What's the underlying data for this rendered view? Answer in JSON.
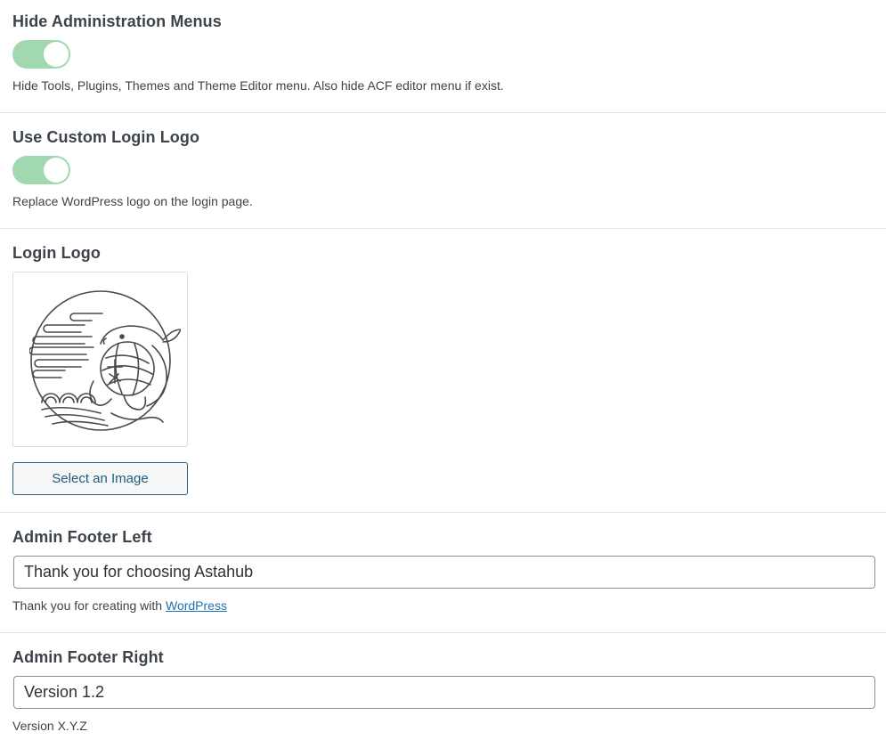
{
  "hide_admin_menus": {
    "label": "Hide Administration Menus",
    "enabled": true,
    "description": "Hide Tools, Plugins, Themes and Theme Editor menu. Also hide ACF editor menu if exist."
  },
  "custom_login_logo": {
    "label": "Use Custom Login Logo",
    "enabled": true,
    "description": "Replace WordPress logo on the login page."
  },
  "login_logo": {
    "label": "Login Logo",
    "image_icon": "mascot-logo-icon",
    "select_button": "Select an Image"
  },
  "footer_left": {
    "label": "Admin Footer Left",
    "value": "Thank you for choosing Astahub",
    "description_prefix": "Thank you for creating with ",
    "description_link": "WordPress"
  },
  "footer_right": {
    "label": "Admin Footer Right",
    "value": "Version 1.2",
    "description": "Version X.Y.Z"
  },
  "colors": {
    "toggle_on": "#a2d8b0",
    "link": "#2271b1",
    "button_border": "#2c5f7c"
  }
}
